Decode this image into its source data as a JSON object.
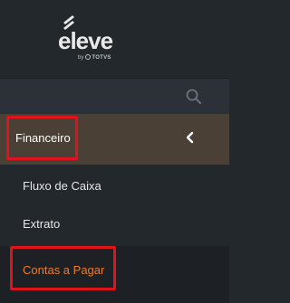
{
  "brand": {
    "logo_word": "eleve",
    "by_text": "by",
    "partner_text": "TOTVS",
    "logo_color": "#e9e9e9"
  },
  "search": {
    "icon": "search-icon"
  },
  "menu": {
    "section": {
      "label": "Financeiro",
      "icon": "chevron-left-icon",
      "background": "#4a4036",
      "highlighted": true
    },
    "items": [
      {
        "label": "Fluxo de Caixa",
        "active": false
      },
      {
        "label": "Extrato",
        "active": false
      },
      {
        "label": "Contas a Pagar",
        "active": true,
        "highlighted": true
      }
    ]
  },
  "colors": {
    "sidebar_bg": "#23282d",
    "active_text": "#f07a2d",
    "annotation_red": "#e1131a"
  }
}
